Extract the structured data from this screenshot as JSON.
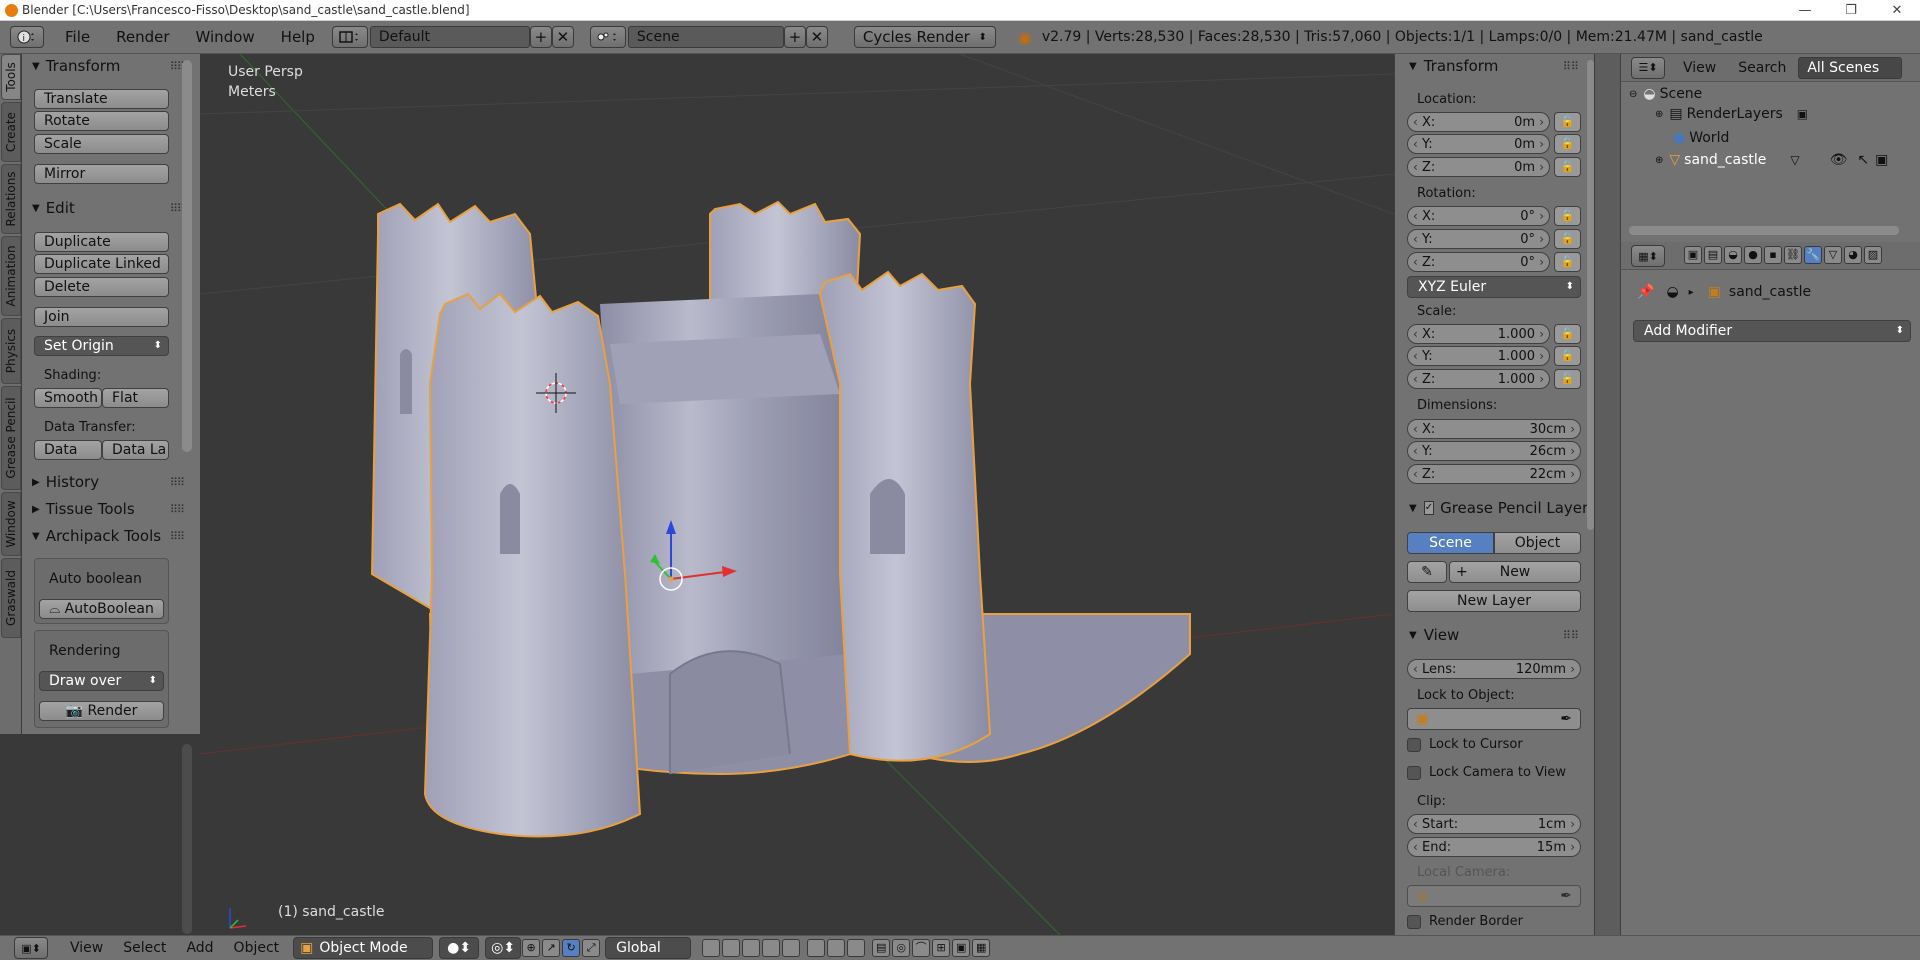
{
  "window": {
    "title": "Blender [C:\\Users\\Francesco-Fisso\\Desktop\\sand_castle\\sand_castle.blend]",
    "controls": [
      "—",
      "❐",
      "✕"
    ]
  },
  "menubar": {
    "info_icon": "info-icon",
    "menus": [
      "File",
      "Render",
      "Window",
      "Help"
    ],
    "screen_layout": "Default",
    "scene": "Scene",
    "render_engine": "Cycles Render",
    "stats": "v2.79 | Verts:28,530 | Faces:28,530 | Tris:57,060 | Objects:1/1 | Lamps:0/0 | Mem:21.47M | sand_castle"
  },
  "left_tabs": [
    "Tools",
    "Create",
    "Relations",
    "Animation",
    "Physics",
    "Grease Pencil",
    "Window",
    "Graswald"
  ],
  "toolshelf": {
    "transform": {
      "title": "Transform",
      "buttons": [
        "Translate",
        "Rotate",
        "Scale",
        "Mirror"
      ]
    },
    "edit": {
      "title": "Edit",
      "buttons": [
        "Duplicate",
        "Duplicate Linked",
        "Delete",
        "Join"
      ],
      "set_origin": "Set Origin"
    },
    "shading": {
      "label": "Shading:",
      "smooth": "Smooth",
      "flat": "Flat"
    },
    "data_transfer": {
      "label": "Data Transfer:",
      "data": "Data",
      "data_la": "Data La"
    },
    "history": "History",
    "tissue_tools": "Tissue Tools",
    "archipack": "Archipack Tools",
    "auto_boolean": {
      "label": "Auto boolean",
      "button": "AutoBoolean"
    },
    "rendering": {
      "label": "Rendering",
      "draw_over": "Draw over",
      "render": "Render"
    }
  },
  "viewport": {
    "view_name": "User Persp",
    "units": "Meters",
    "object_label": "(1) sand_castle"
  },
  "n_panel": {
    "transform_title": "Transform",
    "location_label": "Location:",
    "location": [
      {
        "axis": "X:",
        "value": "0m"
      },
      {
        "axis": "Y:",
        "value": "0m"
      },
      {
        "axis": "Z:",
        "value": "0m"
      }
    ],
    "rotation_label": "Rotation:",
    "rotation": [
      {
        "axis": "X:",
        "value": "0°"
      },
      {
        "axis": "Y:",
        "value": "0°"
      },
      {
        "axis": "Z:",
        "value": "0°"
      }
    ],
    "rotation_mode": "XYZ Euler",
    "scale_label": "Scale:",
    "scale": [
      {
        "axis": "X:",
        "value": "1.000"
      },
      {
        "axis": "Y:",
        "value": "1.000"
      },
      {
        "axis": "Z:",
        "value": "1.000"
      }
    ],
    "dimensions_label": "Dimensions:",
    "dimensions": [
      {
        "axis": "X:",
        "value": "30cm"
      },
      {
        "axis": "Y:",
        "value": "26cm"
      },
      {
        "axis": "Z:",
        "value": "22cm"
      }
    ],
    "grease_pencil_title": "Grease Pencil Layer",
    "gp_scene": "Scene",
    "gp_object": "Object",
    "gp_new": "New",
    "gp_new_layer": "New Layer",
    "view_title": "View",
    "lens_label": "Lens:",
    "lens_value": "120mm",
    "lock_to_object": "Lock to Object:",
    "lock_to_cursor": "Lock to Cursor",
    "lock_camera": "Lock Camera to View",
    "clip_label": "Clip:",
    "clip_start_label": "Start:",
    "clip_start": "1cm",
    "clip_end_label": "End:",
    "clip_end": "15m",
    "local_camera": "Local Camera:",
    "render_border": "Render Border"
  },
  "outliner": {
    "menus": [
      "View",
      "Search"
    ],
    "filter": "All Scenes",
    "rows": [
      "Scene",
      "RenderLayers",
      "World",
      "sand_castle"
    ]
  },
  "properties": {
    "object_name": "sand_castle",
    "add_modifier": "Add Modifier"
  },
  "bottombar": {
    "menus": [
      "View",
      "Select",
      "Add",
      "Object"
    ],
    "mode": "Object Mode",
    "orientation": "Global"
  },
  "colors": {
    "accent_blue": "#5680c2",
    "selection_orange": "#e8a040",
    "panel_bg": "#727272",
    "viewport_bg": "#393939"
  }
}
